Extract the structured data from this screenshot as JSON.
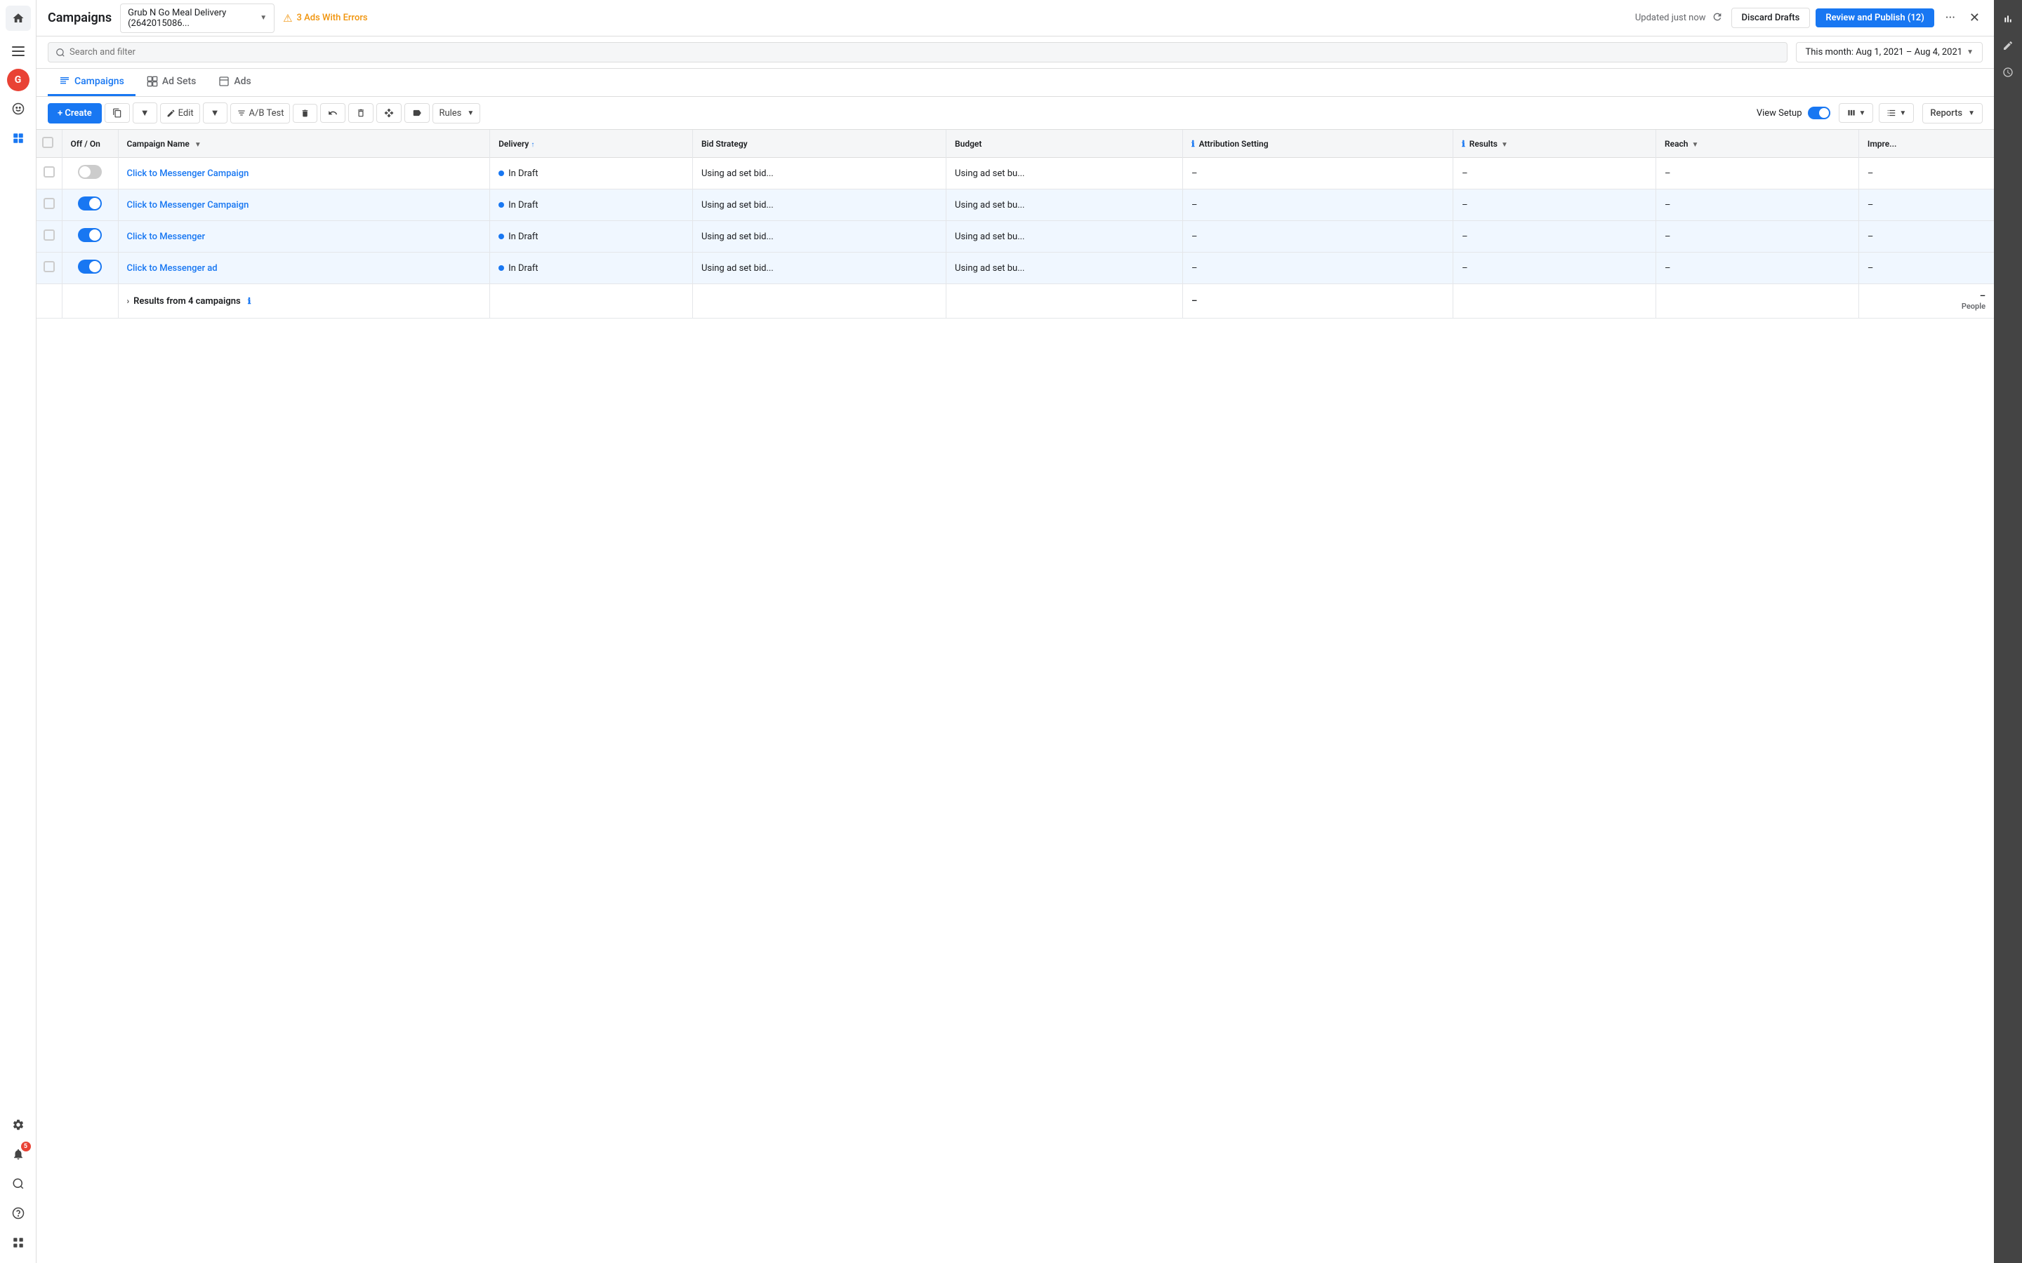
{
  "app": {
    "title": "Campaigns"
  },
  "account": {
    "name": "Grub N Go Meal Delivery (2642015086...",
    "errors_count": "3 Ads With Errors"
  },
  "header": {
    "updated_text": "Updated just now",
    "discard_label": "Discard Drafts",
    "review_publish_label": "Review and Publish (12)"
  },
  "search": {
    "placeholder": "Search and filter",
    "date_range": "This month: Aug 1, 2021 – Aug 4, 2021"
  },
  "tabs": [
    {
      "id": "campaigns",
      "label": "Campaigns",
      "icon": "📋",
      "active": true
    },
    {
      "id": "ad_sets",
      "label": "Ad Sets",
      "icon": "⊞",
      "active": false
    },
    {
      "id": "ads",
      "label": "Ads",
      "icon": "🖼",
      "active": false
    }
  ],
  "toolbar": {
    "create_label": "+ Create",
    "edit_label": "Edit",
    "ab_test_label": "A/B Test",
    "rules_label": "Rules",
    "view_setup_label": "View Setup",
    "reports_label": "Reports"
  },
  "table": {
    "columns": [
      {
        "id": "off_on",
        "label": "Off / On"
      },
      {
        "id": "campaign_name",
        "label": "Campaign Name",
        "sortable": true,
        "sorted": false
      },
      {
        "id": "delivery",
        "label": "Delivery",
        "sortable": true,
        "sorted": true,
        "sort_dir": "asc"
      },
      {
        "id": "bid_strategy",
        "label": "Bid Strategy"
      },
      {
        "id": "budget",
        "label": "Budget"
      },
      {
        "id": "attribution_setting",
        "label": "Attribution Setting",
        "info": true
      },
      {
        "id": "results",
        "label": "Results",
        "info": true
      },
      {
        "id": "reach",
        "label": "Reach"
      },
      {
        "id": "impressions",
        "label": "Impre..."
      }
    ],
    "rows": [
      {
        "id": "row1",
        "toggle_state": "off",
        "campaign_name": "Click to Messenger Campaign",
        "delivery": "In Draft",
        "bid_strategy": "Using ad set bid...",
        "budget": "Using ad set bu...",
        "attribution_setting": "–",
        "results": "–",
        "reach": "–",
        "impressions": "–",
        "highlighted": false
      },
      {
        "id": "row2",
        "toggle_state": "on",
        "campaign_name": "Click to Messenger Campaign",
        "delivery": "In Draft",
        "bid_strategy": "Using ad set bid...",
        "budget": "Using ad set bu...",
        "attribution_setting": "–",
        "results": "–",
        "reach": "–",
        "impressions": "–",
        "highlighted": true
      },
      {
        "id": "row3",
        "toggle_state": "on",
        "campaign_name": "Click to Messenger",
        "delivery": "In Draft",
        "bid_strategy": "Using ad set bid...",
        "budget": "Using ad set bu...",
        "attribution_setting": "–",
        "results": "–",
        "reach": "–",
        "impressions": "–",
        "highlighted": true
      },
      {
        "id": "row4",
        "toggle_state": "on",
        "campaign_name": "Click to Messenger ad",
        "delivery": "In Draft",
        "bid_strategy": "Using ad set bid...",
        "budget": "Using ad set bu...",
        "attribution_setting": "–",
        "results": "–",
        "reach": "–",
        "impressions": "–",
        "highlighted": true
      }
    ],
    "summary": {
      "label": "Results from 4 campaigns",
      "attribution_setting": "–",
      "impressions": "–",
      "people_label": "People"
    }
  },
  "sidebar_left": {
    "home_icon": "⌂",
    "nav_icon": "≡",
    "avatar_letter": "G",
    "icons": [
      "😊",
      "☰"
    ],
    "bottom_icons": [
      "⚙",
      "🔔",
      "🔍",
      "?",
      "⊞"
    ],
    "notification_count": "5"
  },
  "sidebar_right": {
    "icons": [
      "📊",
      "✏️",
      "🕐"
    ]
  }
}
